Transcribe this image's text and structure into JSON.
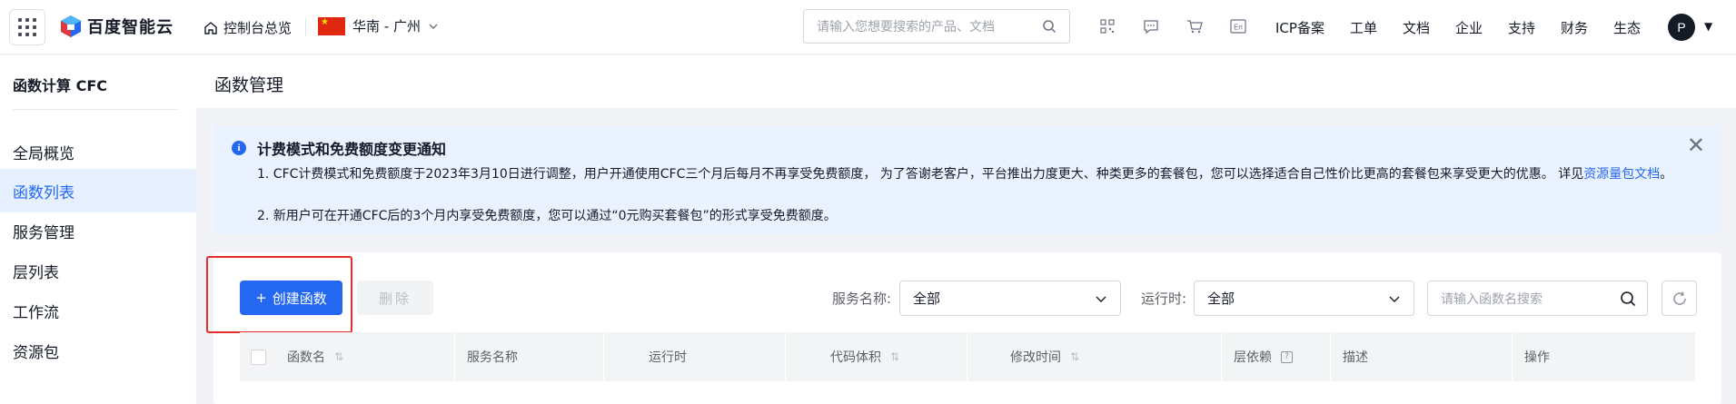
{
  "header": {
    "brand": "百度智能云",
    "home_label": "控制台总览",
    "region": "华南 - 广州",
    "search_placeholder": "请输入您想要搜索的产品、文档",
    "nav": [
      "ICP备案",
      "工单",
      "文档",
      "企业",
      "支持",
      "财务",
      "生态"
    ],
    "avatar_letter": "P",
    "en_icon_text": "En"
  },
  "sidebar": {
    "title": "函数计算 CFC",
    "items": [
      {
        "label": "全局概览",
        "active": false
      },
      {
        "label": "函数列表",
        "active": true
      },
      {
        "label": "服务管理",
        "active": false
      },
      {
        "label": "层列表",
        "active": false
      },
      {
        "label": "工作流",
        "active": false
      },
      {
        "label": "资源包",
        "active": false
      }
    ]
  },
  "page": {
    "title": "函数管理"
  },
  "notice": {
    "title": "计费模式和免费额度变更通知",
    "line1_text": "1. CFC计费模式和免费额度于2023年3月10日进行调整，用户开通使用CFC三个月后每月不再享受免费额度， 为了答谢老客户，平台推出力度更大、种类更多的套餐包，您可以选择适合自己性价比更高的套餐包来享受更大的优惠。 详见",
    "line1_link": "资源量包文档",
    "line1_end": "。",
    "line2_text": "2. 新用户可在开通CFC后的3个月内享受免费额度，您可以通过“0元购买套餐包”的形式享受免费额度。"
  },
  "toolbar": {
    "create_label": "创建函数",
    "delete_label": "删除",
    "service_label": "服务名称:",
    "service_value": "全部",
    "runtime_label": "运行时:",
    "runtime_value": "全部",
    "search_placeholder": "请输入函数名搜索"
  },
  "table": {
    "columns": [
      "函数名",
      "服务名称",
      "运行时",
      "代码体积",
      "修改时间",
      "层依赖",
      "描述",
      "操作"
    ]
  },
  "colors": {
    "accent": "#2468f2",
    "highlight_border": "#e52e2e",
    "notice_bg": "#eaf2ff"
  }
}
